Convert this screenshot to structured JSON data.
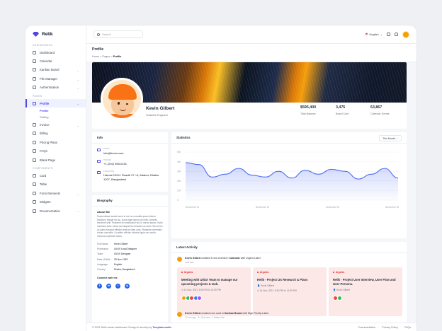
{
  "app": {
    "name": "Relik"
  },
  "sidebar": {
    "sections": [
      {
        "title": "Dashboards",
        "items": [
          {
            "label": "Dashboard",
            "icon": "home-icon"
          },
          {
            "label": "Calendar",
            "icon": "calendar-icon"
          },
          {
            "label": "Kanban Board",
            "icon": "kanban-icon",
            "expandable": true
          },
          {
            "label": "File Manager",
            "icon": "folder-icon",
            "expandable": true
          },
          {
            "label": "Authentication",
            "icon": "lock-icon",
            "expandable": true
          }
        ]
      },
      {
        "title": "Pages",
        "items": [
          {
            "label": "Profile",
            "icon": "user-icon",
            "expandable": true,
            "active": true,
            "children": [
              {
                "label": "Profile",
                "active": true
              },
              {
                "label": "Setting"
              }
            ]
          },
          {
            "label": "Invoice",
            "icon": "invoice-icon",
            "expandable": true
          },
          {
            "label": "Billing",
            "icon": "billing-icon"
          },
          {
            "label": "Pricing Plans",
            "icon": "pricing-icon"
          },
          {
            "label": "FAQs",
            "icon": "faq-icon"
          },
          {
            "label": "Blank Page",
            "icon": "page-icon"
          }
        ]
      },
      {
        "title": "Components",
        "items": [
          {
            "label": "Card",
            "icon": "card-icon"
          },
          {
            "label": "Table",
            "icon": "table-icon"
          },
          {
            "label": "Form Elements",
            "icon": "form-icon",
            "expandable": true
          },
          {
            "label": "Widgets",
            "icon": "widget-icon"
          },
          {
            "label": "Documentation",
            "icon": "doc-icon",
            "expandable": true
          }
        ]
      }
    ]
  },
  "topbar": {
    "search_placeholder": "Search",
    "language": "English"
  },
  "page": {
    "title": "Profile",
    "crumbs": [
      "Home",
      "Pages",
      "Profile"
    ]
  },
  "profile": {
    "name": "Kevin Gilbert",
    "role": "Software Engineer",
    "stats": [
      {
        "value": "$595,400",
        "label": "Total Balance"
      },
      {
        "value": "3,475",
        "label": "Board Card"
      },
      {
        "value": "63,867",
        "label": "Calendar Events"
      }
    ]
  },
  "info": {
    "title": "Info",
    "rows": [
      {
        "label": "Email",
        "value": "info@kevin.com",
        "icon": "mail-icon"
      },
      {
        "label": "Phone",
        "value": "+1 (202) 555-0151",
        "icon": "phone-icon"
      },
      {
        "label": "Location",
        "value": "Hams# 1024 / Road# 17 / A, Adabor, Dhaka-1207, Bangladesh",
        "icon": "location-icon"
      }
    ]
  },
  "bio": {
    "title": "Biography",
    "about_title": "About Me",
    "about_text": "Suspendisse iaculis lorem in dui, ac convallis quam dictum tincidunt. Integer leo ac, luctus eget ipsum vel enim. Aenean hendrerit velit. Praesent vel vestibulum elit, in rutrum ipsum. Nulla maximus dolor varius sed aliquet leo tincidunt ac amet. Sed et leo ac justo euismod efficitur pretium vitae urna. Phasellus venenatis rutrum convallis. Curabitur efficitur lobortis ligula nec mollis. Vivamus a pretium lacus.",
    "details": [
      {
        "k": "Full Name",
        "v": "Kevin Gilbert"
      },
      {
        "k": "Profession",
        "v": "UI/UX Lead Designer"
      },
      {
        "k": "Team",
        "v": "UI/UX Designer"
      },
      {
        "k": "Date of Birth",
        "v": "25 Nov 1993"
      },
      {
        "k": "Language",
        "v": "English"
      },
      {
        "k": "Country",
        "v": "Dhaka, Bangladesh"
      }
    ],
    "connect_title": "Connect with me",
    "social": [
      {
        "icon": "facebook-icon",
        "glyph": "f"
      },
      {
        "icon": "linkedin-icon",
        "glyph": "in"
      },
      {
        "icon": "twitter-icon",
        "glyph": "t"
      },
      {
        "icon": "instagram-icon",
        "glyph": "◎"
      }
    ]
  },
  "statistics": {
    "title": "Statistics",
    "period": "This Month"
  },
  "chart_data": {
    "type": "area",
    "y_ticks": [
      "500",
      "400",
      "300",
      "200",
      "100",
      "0"
    ],
    "x_ticks": [
      "November 01",
      "November 10",
      "November 20",
      "November 30"
    ],
    "x": [
      1,
      2,
      3,
      4,
      5,
      6,
      7,
      8,
      9,
      10,
      11,
      12,
      13,
      14,
      15,
      16,
      17
    ],
    "values": [
      390,
      370,
      240,
      270,
      330,
      260,
      240,
      300,
      230,
      310,
      270,
      320,
      300,
      220,
      270,
      330,
      230
    ],
    "ylim": [
      0,
      500
    ],
    "color": "#4f6cf2"
  },
  "activity": {
    "title": "Latest Activity",
    "items": [
      {
        "who": "Kevin Gilbert",
        "text": "created 3 new events in",
        "target": "Calendar",
        "extra": "with Urgent Label",
        "time": "Just now"
      },
      {
        "who": "Kevin Gilbert",
        "text": "created new card in",
        "target": "Kanban Board",
        "extra": "with High Priority Label",
        "time": "10 min ago  ·  5+ Sub task  ·  3 Attatch file"
      }
    ],
    "tasks": [
      {
        "tag": "Urgents",
        "title": "Meeting with UI/UX Team to manage our upcoming projects & task.",
        "date": "14 Nov, 2021, 8:00 PM to 11:00 PM",
        "avatars": [
          "#f59e0b",
          "#22c55e",
          "#ef4444",
          "#3b82f6",
          "#a855f7"
        ]
      },
      {
        "tag": "Urgents",
        "title": "Relik - Project UX Research & Plans",
        "person": "Kevin Gilbert",
        "date": "14 Nov, 2021, 8:00 PM to 11:00 PM",
        "avatars": []
      },
      {
        "tag": "Urgents",
        "title": "Relik - Project User Interview, User Flow and User Persona.",
        "person": "Kevin Gilbert",
        "avatars": [
          "#ef4444",
          "#22c55e"
        ]
      }
    ]
  },
  "footer": {
    "copyright": "© 2021  Relik admin dashboard. Design & develop by",
    "brand": "Templatecookie",
    "links": [
      "Documentation",
      "Privacy Policy",
      "FAQs"
    ]
  },
  "colors": {
    "accent": "#4f46e5",
    "urgent": "#dc2626",
    "task_bg": "#fde8e8"
  }
}
